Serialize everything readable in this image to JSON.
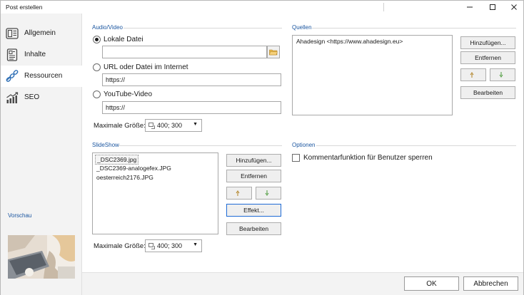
{
  "window": {
    "title": "Post erstellen"
  },
  "sidebar": {
    "items": [
      {
        "label": "Allgemein",
        "icon": "layout-icon"
      },
      {
        "label": "Inhalte",
        "icon": "document-icon"
      },
      {
        "label": "Ressourcen",
        "icon": "link-icon"
      },
      {
        "label": "SEO",
        "icon": "chart-icon"
      }
    ],
    "active": "Ressourcen",
    "preview_label": "Vorschau"
  },
  "audio_video": {
    "section_title": "Audio/Video",
    "local_file_label": "Lokale Datei",
    "local_file_value": "",
    "url_label": "URL oder Datei im Internet",
    "url_value": "https://",
    "youtube_label": "YouTube-Video",
    "youtube_value": "https://",
    "selected_option": "Lokale Datei",
    "max_size_label": "Maximale Größe:",
    "max_size_value": "400; 300"
  },
  "quellen": {
    "section_title": "Quellen",
    "items": [
      "Ahadesign <https://www.ahadesign.eu>"
    ],
    "add_button": "Hinzufügen...",
    "remove_button": "Entfernen",
    "edit_button": "Bearbeiten"
  },
  "slideshow": {
    "section_title": "SlideShow",
    "items": [
      "_DSC2369.jpg",
      "_DSC2369-analogefex.JPG",
      "oesterreich2176.JPG"
    ],
    "selected_index": 0,
    "add_button": "Hinzufügen...",
    "remove_button": "Entfernen",
    "effect_button": "Effekt...",
    "edit_button": "Bearbeiten",
    "max_size_label": "Maximale Größe:",
    "max_size_value": "400; 300"
  },
  "optionen": {
    "section_title": "Optionen",
    "disable_comments_label": "Kommentarfunktion für Benutzer sperren",
    "disable_comments_checked": false
  },
  "footer": {
    "ok_label": "OK",
    "cancel_label": "Abbrechen"
  },
  "colors": {
    "accent": "#1b56a0",
    "sidebar_bg": "#f3f3f3",
    "focus_border": "#1e6bd6"
  }
}
